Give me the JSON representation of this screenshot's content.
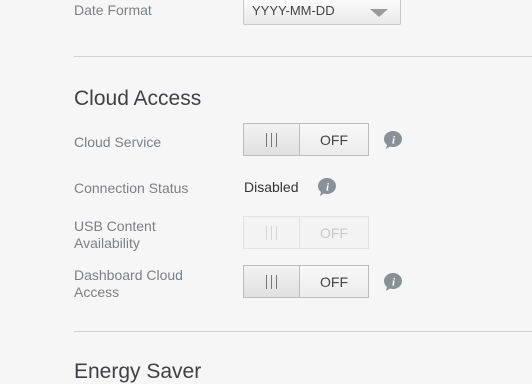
{
  "date_format": {
    "label": "Date Format",
    "value": "YYYY-MM-DD"
  },
  "cloud_access": {
    "title": "Cloud Access",
    "cloud_service": {
      "label": "Cloud Service",
      "state": "OFF"
    },
    "connection_status": {
      "label": "Connection Status",
      "value": "Disabled"
    },
    "usb_content": {
      "label": "USB Content Availability",
      "state": "OFF",
      "disabled": true
    },
    "dashboard_cloud": {
      "label": "Dashboard Cloud Access",
      "state": "OFF"
    }
  },
  "energy_saver": {
    "title": "Energy Saver"
  },
  "colors": {
    "background": "#f6f6f6",
    "label": "#7a8087",
    "info_icon": "#8a9097"
  },
  "icons": [
    "info-icon",
    "chevron-down-icon",
    "toggle-grip-icon"
  ]
}
